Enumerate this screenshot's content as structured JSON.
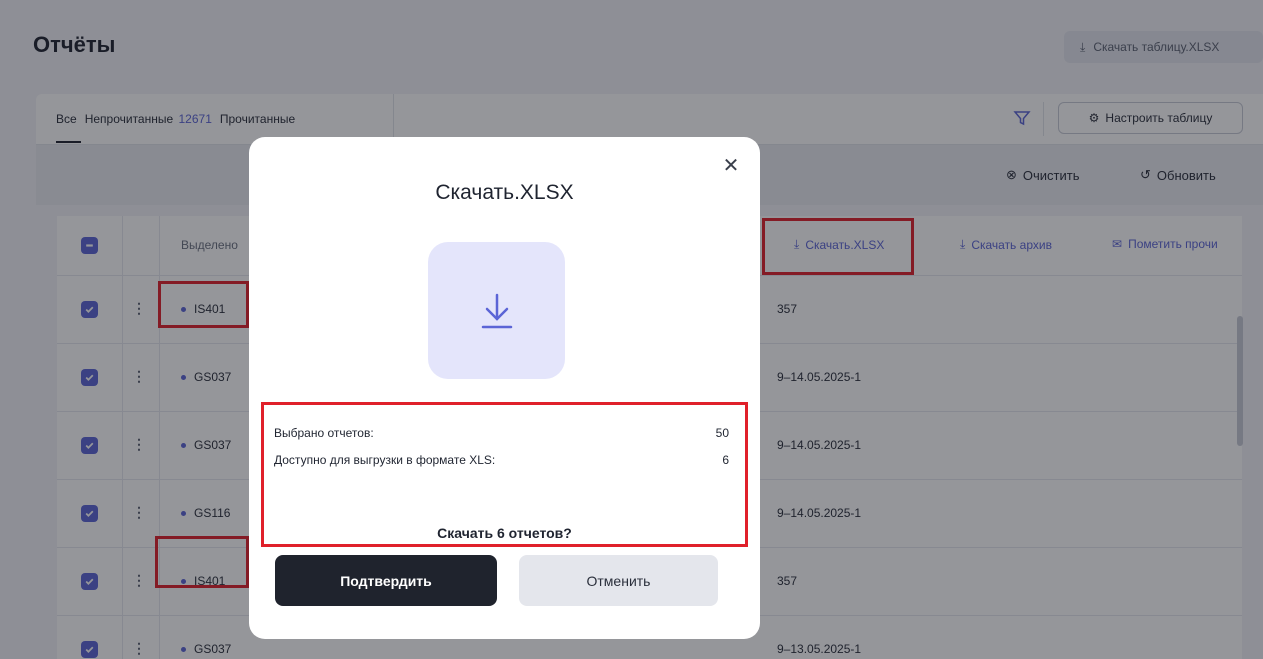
{
  "page": {
    "title": "Отчёты",
    "download_table_label": "Скачать таблицу.XLSX"
  },
  "tabs": [
    {
      "label": "Все"
    },
    {
      "label": "Непрочитанные",
      "count": "12671"
    },
    {
      "label": "Прочитанные"
    }
  ],
  "toolbar": {
    "configure_label": "Настроить таблицу",
    "clear_label": "Очистить",
    "refresh_label": "Обновить"
  },
  "table": {
    "selected_label": "Выделено",
    "actions": {
      "download_xlsx": "Скачать.XLSX",
      "download_archive": "Скачать архив",
      "mark_read": "Пометить прочи"
    },
    "rows": [
      {
        "code": "IS401",
        "number": "357"
      },
      {
        "code": "GS037",
        "number": "9–14.05.2025-1"
      },
      {
        "code": "GS037",
        "number": "9–14.05.2025-1"
      },
      {
        "code": "GS116",
        "number": "9–14.05.2025-1"
      },
      {
        "code": "IS401",
        "number": "357"
      },
      {
        "code": "GS037",
        "number": "9–13.05.2025-1"
      }
    ]
  },
  "modal": {
    "title": "Скачать.XLSX",
    "selected_reports_label": "Выбрано отчетов:",
    "selected_reports_value": "50",
    "available_xls_label": "Доступно для выгрузки в формате XLS:",
    "available_xls_value": "6",
    "question": "Скачать 6 отчетов?",
    "confirm_label": "Подтвердить",
    "cancel_label": "Отменить"
  },
  "colors": {
    "accent": "#5b64d6",
    "highlight": "#e0202a",
    "confirm_bg": "#1f232d"
  },
  "icons": [
    "download-icon",
    "filter-icon",
    "gear-icon",
    "clear-icon",
    "refresh-icon",
    "mail-open-icon",
    "close-icon",
    "checkbox-icon",
    "kebab-icon"
  ]
}
